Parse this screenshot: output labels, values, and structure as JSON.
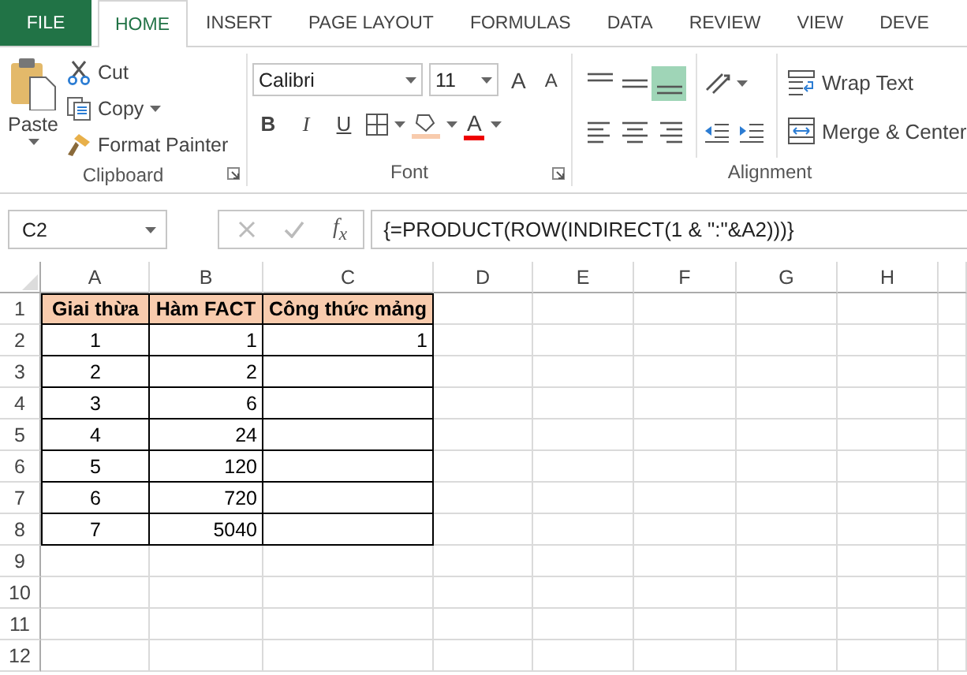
{
  "tabs": [
    {
      "label": "FILE",
      "kind": "file",
      "selected": false
    },
    {
      "label": "HOME",
      "kind": "tab",
      "selected": true
    },
    {
      "label": "INSERT",
      "kind": "tab",
      "selected": false
    },
    {
      "label": "PAGE LAYOUT",
      "kind": "tab",
      "selected": false
    },
    {
      "label": "FORMULAS",
      "kind": "tab",
      "selected": false
    },
    {
      "label": "DATA",
      "kind": "tab",
      "selected": false
    },
    {
      "label": "REVIEW",
      "kind": "tab",
      "selected": false
    },
    {
      "label": "VIEW",
      "kind": "tab",
      "selected": false
    },
    {
      "label": "DEVE",
      "kind": "tab",
      "selected": false
    }
  ],
  "clipboard": {
    "paste": "Paste",
    "items": [
      {
        "kind": "cut",
        "label": "Cut"
      },
      {
        "kind": "copy",
        "label": "Copy"
      },
      {
        "kind": "painter",
        "label": "Format Painter"
      }
    ],
    "label": "Clipboard"
  },
  "font": {
    "name": "Calibri",
    "size": "11",
    "grow": "A",
    "shrink": "A",
    "style_buttons": [
      {
        "kind": "bold",
        "label": "B"
      },
      {
        "kind": "italic",
        "label": "I"
      },
      {
        "kind": "underline",
        "label": "U"
      }
    ],
    "color_button": "A",
    "label": "Font"
  },
  "alignment": {
    "align_buttons": [
      {
        "kind": "top",
        "selected": false
      },
      {
        "kind": "middle",
        "selected": false
      },
      {
        "kind": "bottom",
        "selected": true
      },
      {
        "kind": "left",
        "selected": false
      },
      {
        "kind": "center",
        "selected": false
      },
      {
        "kind": "right",
        "selected": false
      }
    ],
    "wrap": "Wrap Text",
    "merge": "Merge & Center",
    "label": "Alignment"
  },
  "name_box": "C2",
  "fx": "f$_{x}$",
  "formula": "{=PRODUCT(ROW(INDIRECT(1 & \":\"&A2)))}",
  "columns": [
    "A",
    "B",
    "C",
    "D",
    "E",
    "F",
    "G",
    "H"
  ],
  "rows": [
    {
      "number": "1",
      "kind": "header",
      "cells": [
        "Giai thừa",
        "Hàm FACT",
        "Công thức mảng"
      ]
    },
    {
      "number": "2",
      "kind": "data",
      "cells": [
        "1",
        "1",
        "1"
      ]
    },
    {
      "number": "3",
      "kind": "data",
      "cells": [
        "2",
        "2"
      ]
    },
    {
      "number": "4",
      "kind": "data",
      "cells": [
        "3",
        "6"
      ]
    },
    {
      "number": "5",
      "kind": "data",
      "cells": [
        "4",
        "24"
      ]
    },
    {
      "number": "6",
      "kind": "data",
      "cells": [
        "5",
        "120"
      ]
    },
    {
      "number": "7",
      "kind": "data",
      "cells": [
        "6",
        "720"
      ]
    },
    {
      "number": "8",
      "kind": "data",
      "cells": [
        "7",
        "5040"
      ]
    },
    {
      "number": "9",
      "kind": "empty"
    },
    {
      "number": "10",
      "kind": "empty"
    },
    {
      "number": "11",
      "kind": "empty"
    },
    {
      "number": "12",
      "kind": "empty"
    }
  ]
}
